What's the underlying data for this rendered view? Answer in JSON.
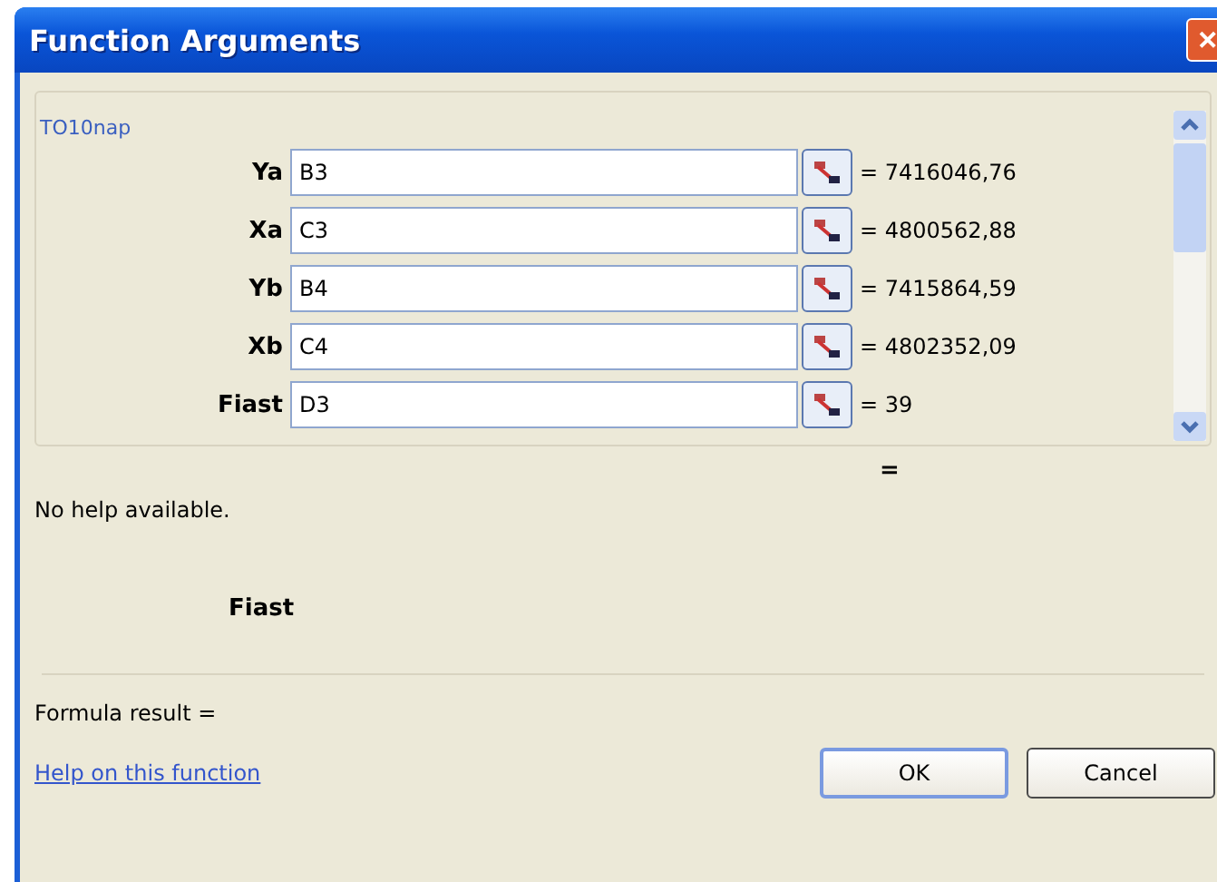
{
  "window": {
    "title": "Function Arguments",
    "close": "✕"
  },
  "group": {
    "title": "TO10nap",
    "arguments": [
      {
        "name": "Ya",
        "value": "B3",
        "result": "= 7416046,76"
      },
      {
        "name": "Xa",
        "value": "C3",
        "result": "= 4800562,88"
      },
      {
        "name": "Yb",
        "value": "B4",
        "result": "= 7415864,59"
      },
      {
        "name": "Xb",
        "value": "C4",
        "result": "= 4802352,09"
      },
      {
        "name": "Fiast",
        "value": "D3",
        "result": "= 39"
      }
    ]
  },
  "function_result": "=",
  "help_text": "No help available.",
  "argument_name": "Fiast",
  "formula_result": "Formula result =",
  "help_link": "Help on this function",
  "buttons": [
    {
      "label": "OK",
      "default": true
    },
    {
      "label": "Cancel",
      "default": false
    }
  ]
}
